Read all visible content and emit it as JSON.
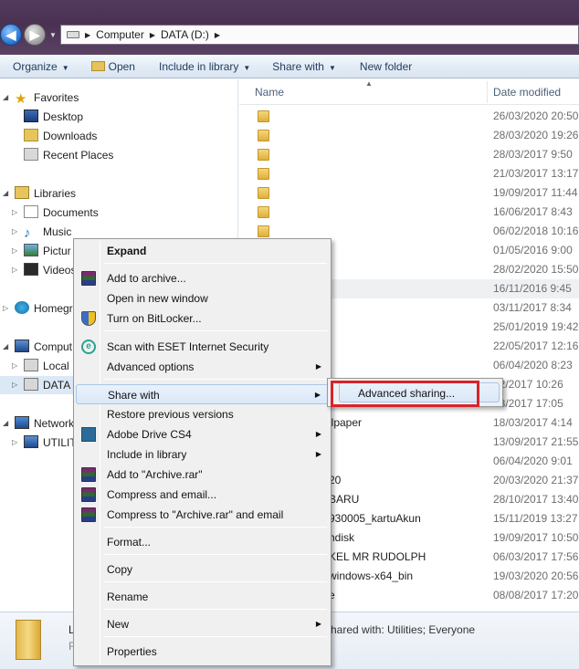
{
  "address": {
    "path": [
      "Computer",
      "DATA (D:)"
    ]
  },
  "toolbar": {
    "organize": "Organize",
    "open": "Open",
    "include_in_library": "Include in library",
    "share_with": "Share with",
    "new_folder": "New folder"
  },
  "nav": {
    "favorites": "Favorites",
    "desktop": "Desktop",
    "downloads": "Downloads",
    "recent_places": "Recent Places",
    "libraries": "Libraries",
    "documents": "Documents",
    "music": "Music",
    "pictures": "Pictur",
    "videos": "Videos",
    "homegroup": "Homegr",
    "computer": "Comput",
    "local_disk": "Local I",
    "data_drive": "DATA",
    "network": "Network",
    "utilities": "UTILIT"
  },
  "columns": {
    "name": "Name",
    "date_modified": "Date modified"
  },
  "files": [
    {
      "name": "",
      "date": "26/03/2020 20:50"
    },
    {
      "name": "",
      "date": "28/03/2020 19:26"
    },
    {
      "name": "",
      "date": "28/03/2017 9:50"
    },
    {
      "name": "",
      "date": "21/03/2017 13:17"
    },
    {
      "name": "",
      "date": "19/09/2017 11:44"
    },
    {
      "name": "",
      "date": "16/06/2017 8:43"
    },
    {
      "name": "",
      "date": "06/02/2018 10:16"
    },
    {
      "name": "",
      "date": "01/05/2016 9:00"
    },
    {
      "name": "",
      "date": "28/02/2020 15:50"
    },
    {
      "name": "",
      "date": "16/11/2016 9:45"
    },
    {
      "name": "",
      "date": "03/11/2017 8:34"
    },
    {
      "name": "",
      "date": "25/01/2019 19:42"
    },
    {
      "name": "",
      "date": "22/05/2017 12:16"
    },
    {
      "name": "",
      "date": "06/04/2020 8:23"
    },
    {
      "name": "",
      "date": "02/2017 10:26"
    },
    {
      "name": "",
      "date": "08/2017 17:05"
    },
    {
      "name": "llpaper",
      "date": "18/03/2017 4:14"
    },
    {
      "name": "",
      "date": "13/09/2017 21:55"
    },
    {
      "name": "",
      "date": "06/04/2020 9:01"
    },
    {
      "name": "20",
      "date": "20/03/2020 21:37"
    },
    {
      "name": "BARU",
      "date": "28/10/2017 13:40"
    },
    {
      "name": "930005_kartuAkun",
      "date": "15/11/2019 13:27"
    },
    {
      "name": "hdisk",
      "date": "19/09/2017 10:50"
    },
    {
      "name": "KEL MR RUDOLPH",
      "date": "06/03/2017 17:56"
    },
    {
      "name": "windows-x64_bin",
      "date": "19/03/2020 20:56"
    },
    {
      "name": "e",
      "date": "08/08/2017 17:20"
    }
  ],
  "details": {
    "name_fragment": "L",
    "type_fragment": "F",
    "shared": "hared with:  Utilities; Everyone"
  },
  "context_menu": {
    "expand": "Expand",
    "add_to_archive": "Add to archive...",
    "open_new_window": "Open in new window",
    "turn_on_bitlocker": "Turn on BitLocker...",
    "scan_eset": "Scan with ESET Internet Security",
    "advanced_options": "Advanced options",
    "share_with": "Share with",
    "restore_previous": "Restore previous versions",
    "adobe_drive": "Adobe Drive CS4",
    "include_in_library": "Include in library",
    "add_to_archive_rar": "Add to \"Archive.rar\"",
    "compress_email": "Compress and email...",
    "compress_rar_email": "Compress to \"Archive.rar\" and email",
    "format": "Format...",
    "copy": "Copy",
    "rename": "Rename",
    "new": "New",
    "properties": "Properties"
  },
  "submenu": {
    "advanced_sharing": "Advanced sharing..."
  },
  "colors": {
    "highlight_box": "#d8232a",
    "menu_hover": "#d9e8f8"
  }
}
